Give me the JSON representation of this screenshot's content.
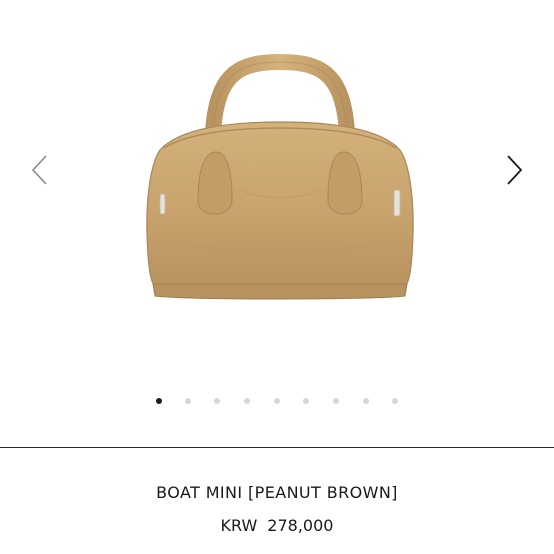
{
  "gallery": {
    "prev_icon": "chevron-left-icon",
    "next_icon": "chevron-right-icon",
    "image_subject": "handbag",
    "image_color": "#c9a46e",
    "slide_count": 9,
    "active_slide": 1
  },
  "product": {
    "name": "BOAT MINI [PEANUT BROWN]",
    "currency": "KRW",
    "price": "278,000"
  }
}
